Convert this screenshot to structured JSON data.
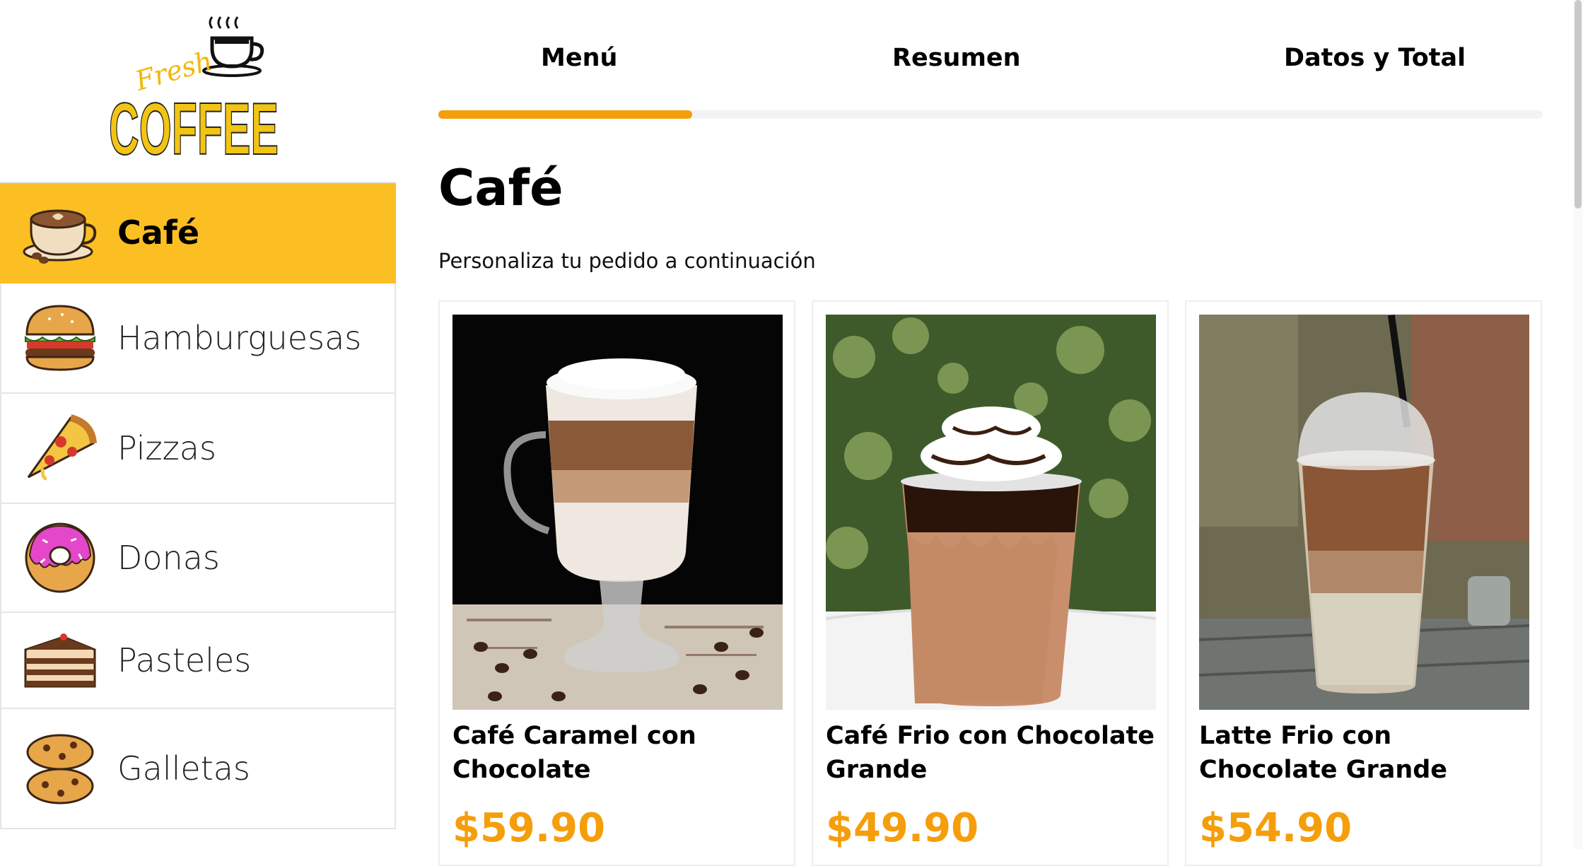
{
  "brand": {
    "logo_text_small": "Fresh",
    "logo_text_big": "COFFEE"
  },
  "sidebar": {
    "categories": [
      {
        "label": "Café",
        "icon": "coffee-cup-icon",
        "active": true
      },
      {
        "label": "Hamburguesas",
        "icon": "burger-icon",
        "active": false
      },
      {
        "label": "Pizzas",
        "icon": "pizza-icon",
        "active": false
      },
      {
        "label": "Donas",
        "icon": "donut-icon",
        "active": false
      },
      {
        "label": "Pasteles",
        "icon": "cake-icon",
        "active": false
      },
      {
        "label": "Galletas",
        "icon": "cookie-icon",
        "active": false
      }
    ]
  },
  "steps": {
    "tabs": [
      "Menú",
      "Resumen",
      "Datos y Total"
    ],
    "progress": 0.23
  },
  "main": {
    "title": "Café",
    "subtitle": "Personaliza tu pedido a continuación"
  },
  "products": [
    {
      "name": "Café Caramel con Chocolate",
      "price": "$59.90"
    },
    {
      "name": "Café Frio con Chocolate Grande",
      "price": "$49.90"
    },
    {
      "name": "Latte Frio con Chocolate Grande",
      "price": "$54.90"
    }
  ],
  "colors": {
    "accent": "#fbbf24",
    "progress": "#f59e0b",
    "price": "#f59e0b"
  }
}
